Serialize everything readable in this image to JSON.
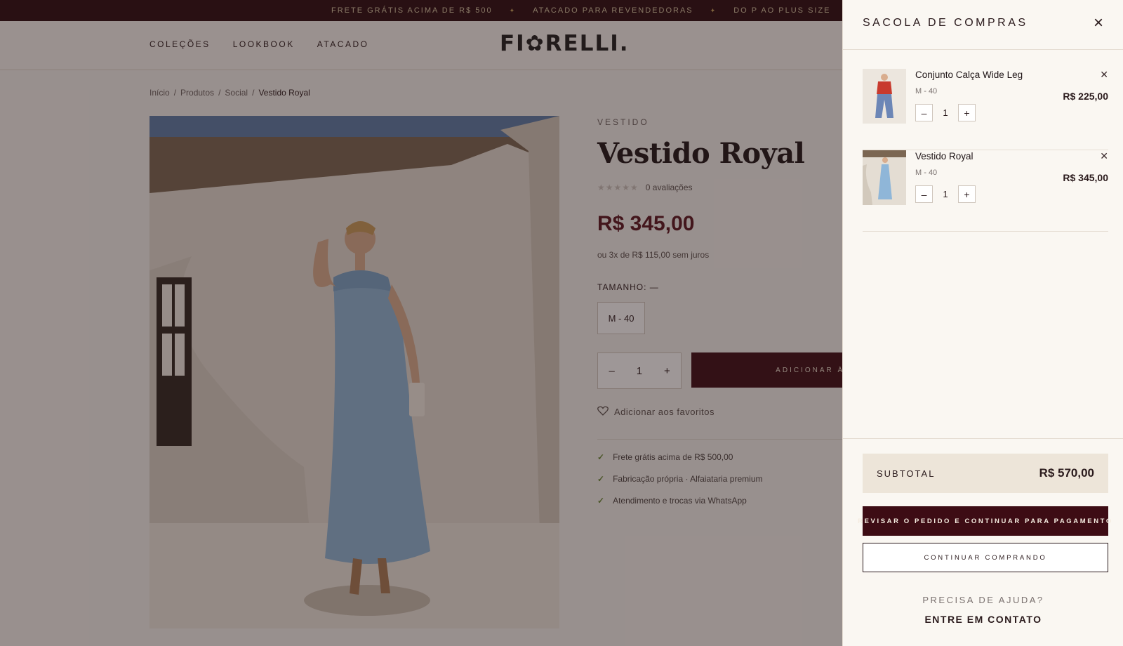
{
  "announcement": {
    "items": [
      "FRETE GRÁTIS ACIMA DE R$ 500",
      "ATACADO PARA REVENDEDORAS",
      "DO P AO PLUS SIZE"
    ]
  },
  "header": {
    "nav": [
      "COLEÇÕES",
      "LOOKBOOK",
      "ATACADO"
    ],
    "logo": "FI✿RELLI."
  },
  "breadcrumb": [
    "Início",
    "Produtos",
    "Social",
    "Vestido Royal"
  ],
  "product": {
    "kicker": "VESTIDO",
    "title": "Vestido Royal",
    "stars": "★★★★★",
    "rating_text": "0 avaliações",
    "price": "R$ 345,00",
    "installments": "ou 3x de R$ 115,00 sem juros",
    "size_label": "TAMANHO: —",
    "size_option": "M - 40",
    "qty": "1",
    "add_button": "ADICIONAR À SACOLA",
    "favorite": "Adicionar aos favoritos",
    "perks": [
      "Frete grátis acima de R$ 500,00",
      "Fabricação própria · Alfaiataria premium",
      "Atendimento e trocas via WhatsApp"
    ]
  },
  "cart": {
    "title": "SACOLA DE COMPRAS",
    "items": [
      {
        "name": "Conjunto Calça Wide Leg",
        "variant": "M - 40",
        "qty": "1",
        "price": "R$ 225,00"
      },
      {
        "name": "Vestido Royal",
        "variant": "M - 40",
        "qty": "1",
        "price": "R$ 345,00"
      }
    ],
    "subtotal_label": "SUBTOTAL",
    "subtotal_value": "R$ 570,00",
    "checkout_button": "REVISAR O PEDIDO E CONTINUAR PARA PAGAMENTO",
    "continue_button": "CONTINUAR COMPRANDO",
    "help_text": "PRECISA DE AJUDA?",
    "contact_link": "ENTRE EM CONTATO"
  },
  "colors": {
    "brand": "#3d0c14",
    "price": "#5a1420",
    "announcement_bg": "#2a0a0f"
  }
}
